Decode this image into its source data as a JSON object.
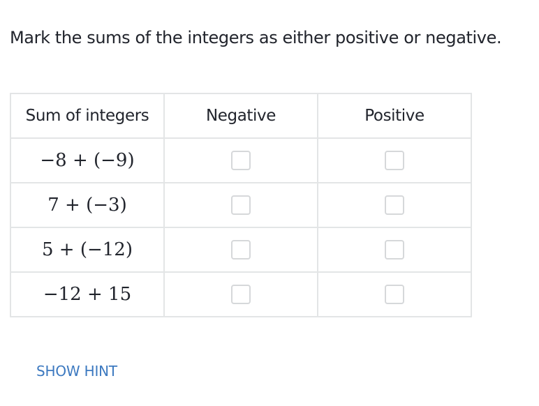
{
  "prompt": "Mark the sums of the integers as either positive or negative.",
  "table": {
    "headers": [
      "Sum of integers",
      "Negative",
      "Positive"
    ],
    "rows": [
      {
        "expression": "−8 + (−9)",
        "negative_checked": false,
        "positive_checked": false
      },
      {
        "expression": "7 + (−3)",
        "negative_checked": false,
        "positive_checked": false
      },
      {
        "expression": "5 + (−12)",
        "negative_checked": false,
        "positive_checked": false
      },
      {
        "expression": "−12 + 15",
        "negative_checked": false,
        "positive_checked": false
      }
    ]
  },
  "hint": {
    "label": "SHOW HINT",
    "color": "#3c79c0"
  },
  "colors": {
    "text": "#21242c",
    "border": "#e3e5e6",
    "checkbox_border": "#d6d8da"
  }
}
